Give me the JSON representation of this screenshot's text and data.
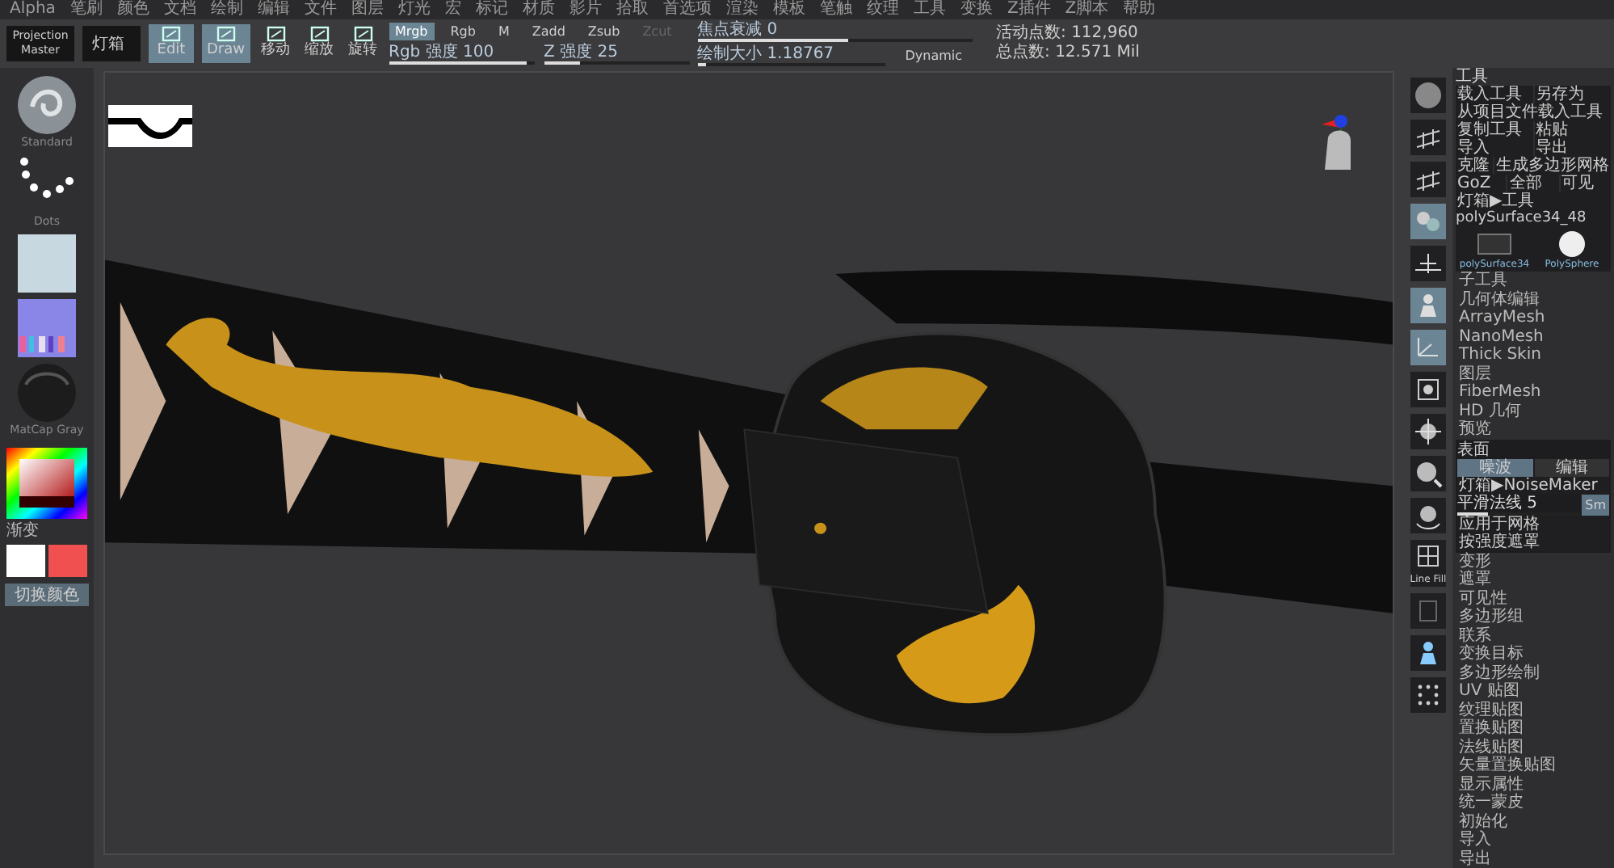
{
  "menu_bar": [
    "Alpha",
    "笔刷",
    "颜色",
    "文档",
    "绘制",
    "编辑",
    "文件",
    "图层",
    "灯光",
    "宏",
    "标记",
    "材质",
    "影片",
    "拾取",
    "首选项",
    "渲染",
    "模板",
    "笔触",
    "纹理",
    "工具",
    "变换",
    "Z插件",
    "Z脚本",
    "帮助"
  ],
  "toolbar": {
    "projection_master": "Projection Master",
    "lightbox": "灯箱",
    "mode_buttons": [
      {
        "label": "Edit",
        "selected": true
      },
      {
        "label": "Draw",
        "selected": true
      },
      {
        "label": "移动",
        "selected": false
      },
      {
        "label": "缩放",
        "selected": false
      },
      {
        "label": "旋转",
        "selected": false
      }
    ],
    "channel_buttons": [
      {
        "label": "Mrgb",
        "selected": true
      },
      {
        "label": "Rgb",
        "selected": false
      },
      {
        "label": "M",
        "selected": false
      }
    ],
    "z_buttons": [
      {
        "label": "Zadd",
        "disabled": false
      },
      {
        "label": "Zsub",
        "disabled": false
      },
      {
        "label": "Zcut",
        "disabled": true
      }
    ],
    "sliders": [
      {
        "label": "Rgb 强度 100",
        "level": 0.95
      },
      {
        "label": "Z 强度 25",
        "level": 0.25
      },
      {
        "label": "焦点衰减 0",
        "level": 0.55
      },
      {
        "label": "绘制大小 1.18767",
        "level": 0.05
      }
    ],
    "dynamic": "Dynamic",
    "stats": [
      "活动点数: 112,960",
      "总点数: 12.571 Mil"
    ]
  },
  "left_shelf": {
    "items": [
      {
        "kind": "brush",
        "label": "Standard"
      },
      {
        "kind": "stroke",
        "label": "Dots"
      },
      {
        "kind": "alpha"
      },
      {
        "kind": "texture"
      },
      {
        "kind": "material",
        "label": "MatCap Gray"
      }
    ],
    "gradient_label": "渐变",
    "swatches": [
      {
        "color": "#ffffff"
      },
      {
        "color": "#f05050"
      }
    ],
    "switch_label": "切换颜色"
  },
  "right_tools": [
    {
      "kind": "sphere",
      "selected": false
    },
    {
      "kind": "grid",
      "selected": false
    },
    {
      "kind": "grid",
      "selected": false
    },
    {
      "kind": "local",
      "selected": true
    },
    {
      "kind": "floor",
      "selected": false
    },
    {
      "kind": "person",
      "selected": true
    },
    {
      "kind": "xyz",
      "selected": true
    },
    {
      "kind": "frame",
      "selected": false
    },
    {
      "kind": "move",
      "selected": false
    },
    {
      "kind": "scale",
      "selected": false
    },
    {
      "kind": "rotate",
      "selected": false
    },
    {
      "kind": "linefill",
      "label": "Line Fill",
      "selected": false
    },
    {
      "kind": "blank",
      "selected": false
    },
    {
      "kind": "solo",
      "selected": false
    },
    {
      "kind": "dots",
      "selected": false
    }
  ],
  "tool_panel": {
    "title": "工具",
    "button_rows": [
      [
        "载入工具",
        "另存为"
      ],
      [
        "从项目文件载入工具"
      ],
      [
        "复制工具",
        "粘贴"
      ],
      [
        "导入",
        "导出"
      ],
      [
        "克隆",
        "生成多边形网格"
      ],
      [
        "GoZ",
        "全部",
        "可见"
      ]
    ],
    "lightbox_tool": "灯箱▶工具",
    "current_tool": "polySurface34_48",
    "thumbnails": [
      {
        "kind": "mesh",
        "label": "polySurface34"
      },
      {
        "kind": "sphere",
        "label": "PolySphere"
      }
    ],
    "subpalettes": [
      "子工具",
      "几何体编辑",
      "ArrayMesh",
      "NanoMesh",
      "Thick Skin",
      "图层",
      "FiberMesh",
      "HD 几何",
      "预览"
    ],
    "surface": {
      "title": "表面",
      "tabs": [
        {
          "label": "噪波",
          "selected": true
        },
        {
          "label": "编辑",
          "selected": false
        }
      ],
      "lightbox_noise": "灯箱▶NoiseMaker",
      "smooth": {
        "label": "平滑法线 5",
        "level": 0.25
      },
      "smooth_button": "Sm",
      "apply": "应用于网格",
      "bottom_button": "按强度遮罩"
    },
    "lower_list": [
      "变形",
      "遮罩",
      "可见性",
      "多边形组",
      "联系",
      "变换目标",
      "多边形绘制",
      "UV 贴图",
      "纹理贴图",
      "置换贴图",
      "法线贴图",
      "矢量置换贴图",
      "显示属性",
      "统一蒙皮",
      "初始化",
      "导入",
      "导出"
    ]
  }
}
